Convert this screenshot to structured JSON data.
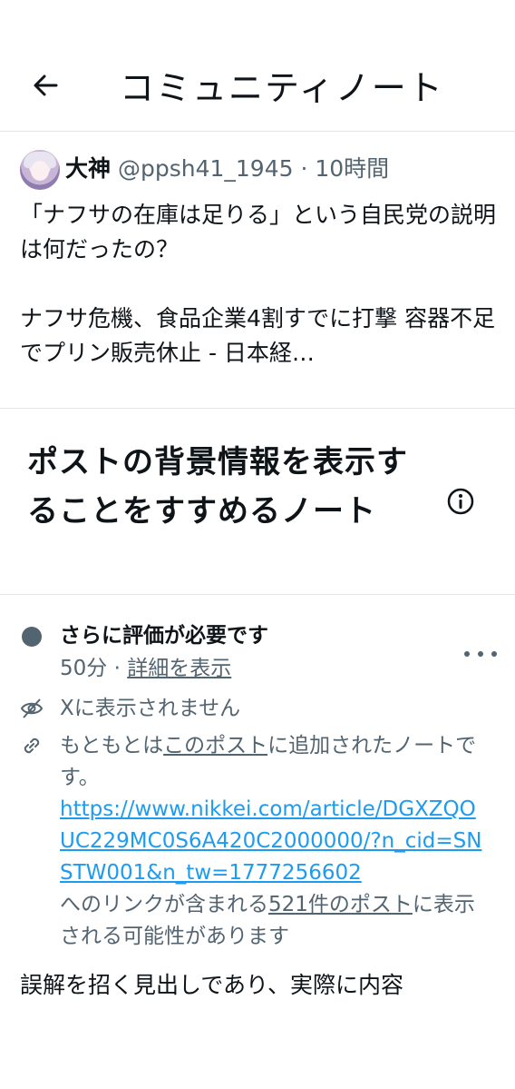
{
  "header": {
    "title": "コミュニティノート"
  },
  "tweet": {
    "author_name": "大神",
    "author_handle": "@ppsh41_1945",
    "separator": "·",
    "time": "10時間",
    "text_line1": "「ナフサの在庫は足りる」という自民党の説明は何だったの？",
    "text_line2": "ナフサ危機、食品企業4割すでに打撃 容器不足でプリン販売休止 - 日本経…"
  },
  "note": {
    "heading": "ポストの背景情報を表示することをすすめるノート",
    "status_title": "さらに評価が必要です",
    "status_time": "50分",
    "status_sep": "·",
    "details_link": "詳細を表示",
    "not_shown": "Xに表示されません",
    "origin_prefix": "もともとは",
    "origin_link": "このポスト",
    "origin_suffix": "に追加されたノートです。",
    "url": "https://www.nikkei.com/article/DGXZQOUC229MC0S6A420C2000000/?n_cid=SNSTW001&n_tw=1777256602",
    "link_prefix": "へのリンクが含まれる",
    "posts_link": "521件のポスト",
    "link_suffix": "に表示される可能性があります",
    "body": "誤解を招く見出しであり、実際に内容"
  },
  "icons": {
    "back": "arrow-left-icon",
    "info": "info-circle-icon",
    "more": "more-dots-icon",
    "not_shown": "eye-off-icon",
    "origin": "link-icon"
  },
  "colors": {
    "link": "#1d9bf0",
    "muted": "#536471",
    "text": "#0f1419"
  }
}
